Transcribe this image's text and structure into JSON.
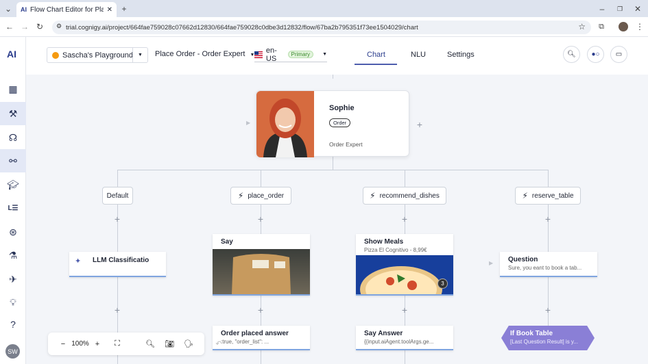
{
  "browser": {
    "tab_title": "Flow Chart Editor for Place Orde",
    "tab_logo": "AI",
    "url": "trial.cognigy.ai/project/664fae759028c07662d12830/664fae759028c0dbe3d12832/flow/67ba2b795351f73ee1504029/chart",
    "icons": [
      "chevron-down-icon",
      "close-icon",
      "plus-icon",
      "back-icon",
      "forward-icon",
      "reload-icon",
      "tune-icon",
      "star-icon",
      "extension-icon",
      "profile-icon",
      "kebab-icon",
      "minimize-icon",
      "maximize-icon",
      "window-close-icon"
    ]
  },
  "app": {
    "logo": "AI",
    "project": "Sascha's Playground",
    "flow": "Place Order - Order Expert",
    "locale": "en-US",
    "locale_badge": "Primary",
    "tabs": [
      {
        "label": "Chart",
        "active": true
      },
      {
        "label": "NLU"
      },
      {
        "label": "Settings"
      }
    ],
    "user_initials": "SW",
    "help": "?",
    "nav_icons": [
      "dashboard-icon",
      "build-icon",
      "agent-icon",
      "flow-icon",
      "train-icon",
      "lexicon-icon",
      "integration-icon",
      "test-icon",
      "deploy-icon",
      "insights-icon"
    ],
    "accent": "#4e5dad",
    "project_dot_color": "#f59a10"
  },
  "flow": {
    "start": {
      "name": "Sophie",
      "badge": "Order",
      "role": "Order Expert"
    },
    "branches": [
      {
        "label": "Default",
        "icon": ""
      },
      {
        "label": "place_order",
        "icon": "bolt-icon"
      },
      {
        "label": "recommend_dishes",
        "icon": "bolt-icon"
      },
      {
        "label": "reserve_table",
        "icon": "bolt-icon"
      }
    ],
    "nodes": {
      "llm": {
        "title": "LLM Classificatio"
      },
      "say": {
        "title": "Say"
      },
      "meals": {
        "title": "Show Meals",
        "subtitle": "Pizza El Cognitivo - 8,99€",
        "badge": "3"
      },
      "question": {
        "title": "Question",
        "subtitle": "Sure, you eant to book a tab..."
      },
      "order_answer": {
        "title": "Order placed answer",
        "subtitle": ":true, \"order_list\": ..."
      },
      "say_answer": {
        "title": "Say Answer",
        "subtitle": "{{input.aiAgent.toolArgs.ge..."
      },
      "if_table": {
        "title": "If Book Table",
        "subtitle": "[Last Question Result] is y..."
      }
    }
  },
  "toolbar": {
    "zoom": "100%",
    "minus": "−",
    "plus": "+"
  }
}
